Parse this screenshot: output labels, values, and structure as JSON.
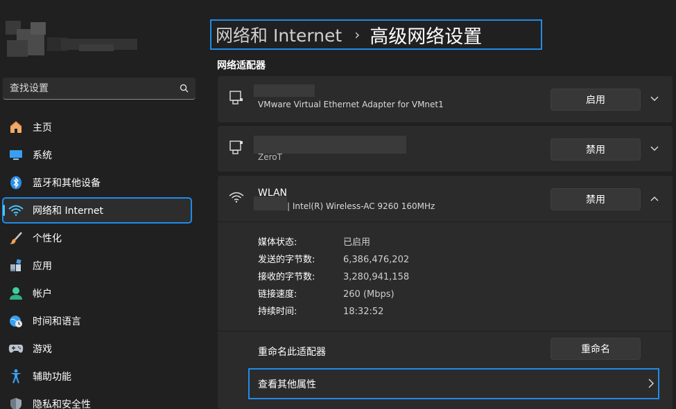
{
  "sidebar": {
    "search_placeholder": "查找设置",
    "items": [
      {
        "label": "主页",
        "icon": "home-icon"
      },
      {
        "label": "系统",
        "icon": "system-display-icon"
      },
      {
        "label": "蓝牙和其他设备",
        "icon": "bluetooth-icon"
      },
      {
        "label": "网络和 Internet",
        "icon": "wifi-icon",
        "active": true
      },
      {
        "label": "个性化",
        "icon": "paintbrush-icon"
      },
      {
        "label": "应用",
        "icon": "apps-icon"
      },
      {
        "label": "帐户",
        "icon": "account-icon"
      },
      {
        "label": "时间和语言",
        "icon": "globe-clock-icon"
      },
      {
        "label": "游戏",
        "icon": "gamepad-icon"
      },
      {
        "label": "辅助功能",
        "icon": "accessibility-icon"
      },
      {
        "label": "隐私和安全性",
        "icon": "shield-icon"
      }
    ]
  },
  "breadcrumb": {
    "parent": "网络和 Internet",
    "separator": "›",
    "current": "高级网络设置"
  },
  "section_title": "网络适配器",
  "adapters": [
    {
      "subtitle": "VMware Virtual Ethernet Adapter for VMnet1",
      "button": "启用",
      "icon": "ethernet-icon"
    },
    {
      "subtitle": "ZeroT",
      "button": "禁用",
      "icon": "ethernet-icon"
    },
    {
      "title": "WLAN",
      "subtitle": "| Intel(R) Wireless-AC 9260 160MHz",
      "button": "禁用",
      "icon": "wifi-icon",
      "expanded": true,
      "details": [
        {
          "key": "媒体状态:",
          "value": "已启用"
        },
        {
          "key": "发送的字节数:",
          "value": "6,386,476,202"
        },
        {
          "key": "接收的字节数:",
          "value": "3,280,941,158"
        },
        {
          "key": "链接速度:",
          "value": "260 (Mbps)"
        },
        {
          "key": "持续时间:",
          "value": "18:32:52"
        }
      ],
      "rename_label": "重命名此适配器",
      "rename_button": "重命名",
      "more_label": "查看其他属性"
    }
  ],
  "colors": {
    "background": "#202020",
    "card": "#2b2b2b",
    "button": "#373737",
    "accent": "#4cc2ff",
    "highlight_border": "#1f8ceb"
  }
}
